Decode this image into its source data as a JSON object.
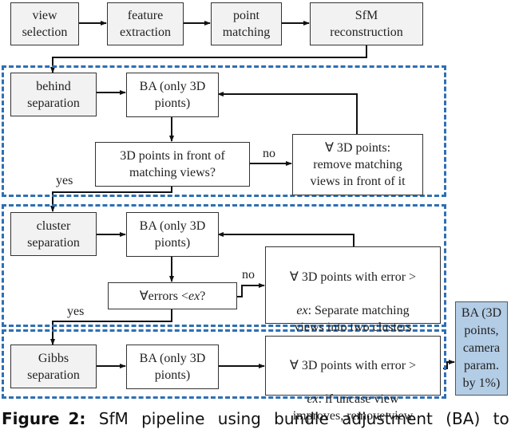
{
  "top_row": [
    {
      "id": "view-selection",
      "text": "view\nselection"
    },
    {
      "id": "feature-extraction",
      "text": "feature\nextraction"
    },
    {
      "id": "point-matching",
      "text": "point\nmatching"
    },
    {
      "id": "sfm-reconstruction",
      "text": "SfM\nreconstruction"
    }
  ],
  "groups": [
    {
      "name": "behind",
      "start": "behind\nseparation",
      "ba": "BA (only 3D\npionts)",
      "decision": "3D points in front of\nmatching views?",
      "action": "∀ 3D points:\nremove matching\nviews in front of it",
      "no_label": "no",
      "yes_label": "yes"
    },
    {
      "name": "cluster",
      "start": "cluster\nseparation",
      "ba": "BA (only 3D\npionts)",
      "decision_prefix": "∀errors < ",
      "decision_var": "ex",
      "decision_suffix": "?",
      "action_line1": "∀ 3D points with error >",
      "action_var": "ex",
      "action_rest": ": Separate matching\nviews into two clusters\nwith k-means",
      "no_label": "no",
      "yes_label": "yes"
    },
    {
      "name": "gibbs",
      "start": "Gibbs\nseparation",
      "ba": "BA (only 3D\npionts)",
      "action_line1": "∀ 3D points with error >",
      "action_var": "ex",
      "action_rest": ": if uncase view\nimproves, remove view"
    }
  ],
  "final_box": "BA (3D\npoints,\ncamera\nparam.\nby 1%)",
  "caption": {
    "label": "Figure 2:",
    "text": "SfM pipeline using bundle adjustment (BA) to"
  },
  "colors": {
    "group_border": "#2e6fb3",
    "final_box_fill": "#b3cde6",
    "grey_box_fill": "#f2f2f2"
  }
}
